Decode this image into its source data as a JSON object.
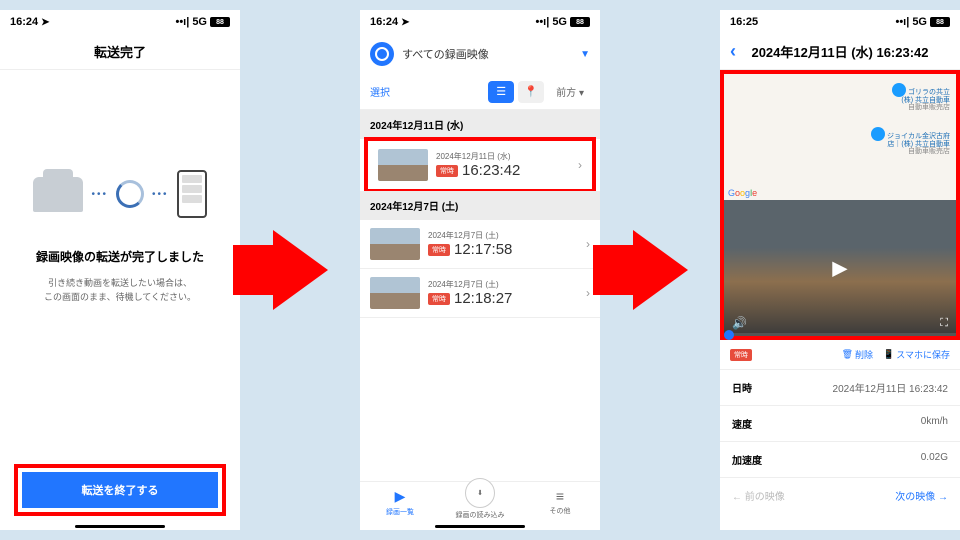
{
  "status": {
    "time1": "16:24",
    "time2": "16:24",
    "time3": "16:25",
    "net": "5G",
    "bat": "88",
    "signal": "••ı|"
  },
  "s1": {
    "header": "転送完了",
    "title": "録画映像の転送が完了しました",
    "sub1": "引き続き動画を転送したい場合は、",
    "sub2": "この画面のまま、待機してください。",
    "btn": "転送を終了する"
  },
  "s2": {
    "filter": "すべての録画映像",
    "select": "選択",
    "dir": "前方",
    "groups": [
      {
        "date": "2024年12月11日 (水)",
        "items": [
          {
            "date": "2024年12月11日 (水)",
            "time": "16:23:42",
            "badge": "常時",
            "hl": true
          }
        ]
      },
      {
        "date": "2024年12月7日 (土)",
        "items": [
          {
            "date": "2024年12月7日 (土)",
            "time": "12:17:58",
            "badge": "常時"
          },
          {
            "date": "2024年12月7日 (土)",
            "time": "12:18:27",
            "badge": "常時"
          }
        ]
      }
    ],
    "tabs": {
      "list": "録画一覧",
      "import": "録画の読み込み",
      "other": "その他"
    }
  },
  "s3": {
    "title": "2024年12月11日 (水) 16:23:42",
    "poi1": {
      "l1": "ゴリラの共立",
      "l2": "(株) 共立自動車",
      "l3": "自動車販売店"
    },
    "poi2": {
      "l1": "ジョイカル金沢古府",
      "l2": "店｜(株) 共立自動車",
      "l3": "自動車販売店"
    },
    "badge": "常時",
    "delete": "削除",
    "save": "スマホに保存",
    "rows": [
      {
        "k": "日時",
        "v": "2024年12月11日 16:23:42"
      },
      {
        "k": "速度",
        "v": "0km/h"
      },
      {
        "k": "加速度",
        "v": "0.02G"
      }
    ],
    "prev": "← 前の映像",
    "next": "次の映像 →"
  }
}
